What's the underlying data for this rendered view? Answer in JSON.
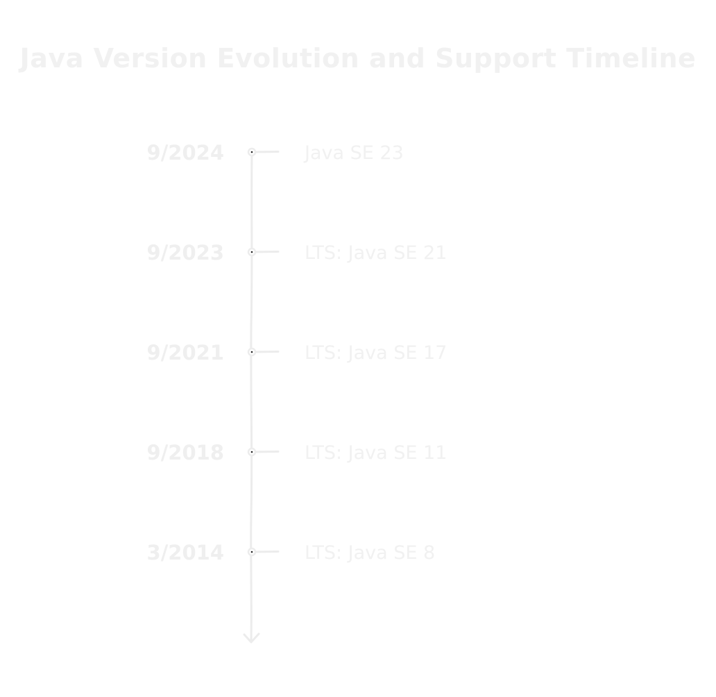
{
  "title": "Java Version Evolution and Support Timeline",
  "colors": {
    "background": "#ffffff",
    "ink": "#ececec",
    "node_core": "#222222"
  },
  "events": [
    {
      "date": "9/2024",
      "label": "Java SE 23"
    },
    {
      "date": "9/2023",
      "label": "LTS: Java SE 21"
    },
    {
      "date": "9/2021",
      "label": "LTS: Java SE 17"
    },
    {
      "date": "9/2018",
      "label": "LTS: Java SE 11"
    },
    {
      "date": "3/2014",
      "label": "LTS: Java SE 8"
    }
  ]
}
